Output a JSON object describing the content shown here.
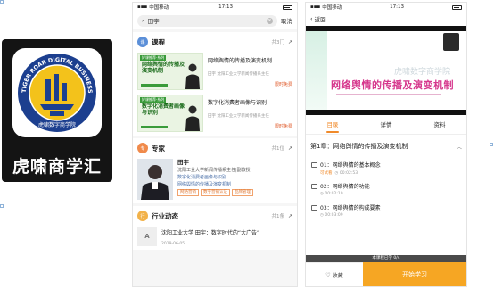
{
  "app_icon": {
    "name": "虎啸商学汇",
    "logo_text_outer": "TIGER ROAR DIGITAL BUSINESS SCHOOL",
    "logo_text_inner": "虎啸数字商学院"
  },
  "screen2": {
    "status": {
      "carrier": "中国移动",
      "time": "17:13",
      "battery": ""
    },
    "search": {
      "query": "田宇",
      "cancel": "取消"
    },
    "courses": {
      "title": "课程",
      "count": "共3门",
      "items": [
        {
          "thumb_tag": "好课推荐·系列",
          "thumb_title": "网络舆情的传播及演变机制",
          "title": "网络舆情的传播及演变机制",
          "subtitle": "田宇  沈阳工业大学新闻传播系主任",
          "price": "限时免费"
        },
        {
          "thumb_tag": "好课推荐·系列",
          "thumb_title": "数字化消费者画像与识别",
          "title": "数字化消费者画像与识别",
          "subtitle": "田宇  沈阳工业大学新闻传播系主任",
          "price": "限时免费"
        }
      ]
    },
    "experts": {
      "title": "专家",
      "count": "共1位",
      "name": "田宇",
      "desc": "沈阳工业大学新闻传播系主任|副教授",
      "course_1": "数字化消费者画像与识别",
      "course_2": "网络舆情的传播及演变机制",
      "chip_1": "网络营销",
      "chip_2": "数字营销认证",
      "chip_3": "品牌管理"
    },
    "news": {
      "title": "行业动态",
      "count": "共1条",
      "logo": "A",
      "headline": "沈阳工业大学 田宇：数字时代的“大广告”",
      "date": "2019-06-05"
    }
  },
  "screen3": {
    "status": {
      "carrier": "中国移动",
      "time": "17:13"
    },
    "back": "返回",
    "video": {
      "title": "网络舆情的传播及演变机制",
      "watermark": "虎啸数字商学院"
    },
    "tabs": [
      "目录",
      "详情",
      "资料"
    ],
    "chapter": "第1章：网络舆情的传播及演变机制",
    "lessons": [
      {
        "title": "01：网络舆情的基本概念",
        "tag": "可试看",
        "duration": "00:02:53"
      },
      {
        "title": "02：网络舆情的功能",
        "tag": "",
        "duration": "00:02:10"
      },
      {
        "title": "03：网络舆情的构成要素",
        "tag": "",
        "duration": "00:03:09"
      }
    ],
    "trial_bar": "本课程已学 0/4",
    "fav": "收藏",
    "start": "开始学习"
  }
}
